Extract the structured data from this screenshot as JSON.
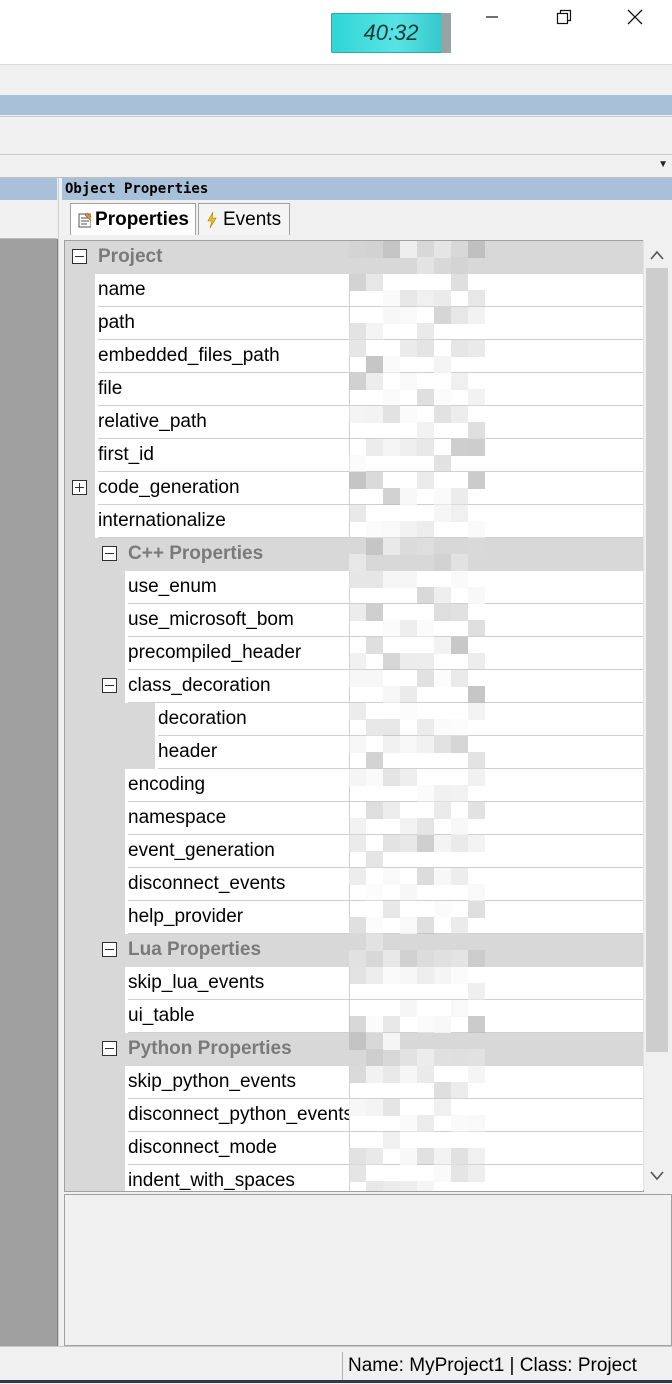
{
  "timer": {
    "display": "40:32"
  },
  "window_controls": {
    "minimize": "—",
    "maximize": "❐",
    "close": "✕"
  },
  "panel": {
    "title": "Object Properties"
  },
  "tabs": [
    {
      "label": "Properties",
      "icon": "properties-icon",
      "active": true
    },
    {
      "label": "Events",
      "icon": "lightning-icon",
      "active": false
    }
  ],
  "grid": {
    "rows": [
      {
        "label": "Project",
        "type": "category",
        "level": 0,
        "expander": "minus"
      },
      {
        "label": "name",
        "type": "property",
        "level": 0
      },
      {
        "label": "path",
        "type": "property",
        "level": 0
      },
      {
        "label": "embedded_files_path",
        "type": "property",
        "level": 0
      },
      {
        "label": "file",
        "type": "property",
        "level": 0
      },
      {
        "label": "relative_path",
        "type": "property",
        "level": 0
      },
      {
        "label": "first_id",
        "type": "property",
        "level": 0
      },
      {
        "label": "code_generation",
        "type": "property",
        "level": 0,
        "expander": "plus"
      },
      {
        "label": "internationalize",
        "type": "property",
        "level": 0
      },
      {
        "label": "C++ Properties",
        "type": "category",
        "level": 1,
        "expander": "minus"
      },
      {
        "label": "use_enum",
        "type": "property",
        "level": 1
      },
      {
        "label": "use_microsoft_bom",
        "type": "property",
        "level": 1
      },
      {
        "label": "precompiled_header",
        "type": "property",
        "level": 1
      },
      {
        "label": "class_decoration",
        "type": "property",
        "level": 1,
        "expander": "minus"
      },
      {
        "label": "decoration",
        "type": "property",
        "level": 2
      },
      {
        "label": "header",
        "type": "property",
        "level": 2
      },
      {
        "label": "encoding",
        "type": "property",
        "level": 1
      },
      {
        "label": "namespace",
        "type": "property",
        "level": 1
      },
      {
        "label": "event_generation",
        "type": "property",
        "level": 1
      },
      {
        "label": "disconnect_events",
        "type": "property",
        "level": 1
      },
      {
        "label": "help_provider",
        "type": "property",
        "level": 1
      },
      {
        "label": "Lua Properties",
        "type": "category",
        "level": 1,
        "expander": "minus"
      },
      {
        "label": "skip_lua_events",
        "type": "property",
        "level": 1
      },
      {
        "label": "ui_table",
        "type": "property",
        "level": 1
      },
      {
        "label": "Python Properties",
        "type": "category",
        "level": 1,
        "expander": "minus"
      },
      {
        "label": "skip_python_events",
        "type": "property",
        "level": 1
      },
      {
        "label": "disconnect_python_events",
        "type": "property",
        "level": 1
      },
      {
        "label": "disconnect_mode",
        "type": "property",
        "level": 1
      },
      {
        "label": "indent_with_spaces",
        "type": "property",
        "level": 1
      }
    ]
  },
  "status": {
    "text": "Name: MyProject1 | Class: Project"
  },
  "colors": {
    "header_blue": "#a9c1d8",
    "category_gray": "#d8d8d8",
    "timer_cyan": "#30d6d6"
  }
}
